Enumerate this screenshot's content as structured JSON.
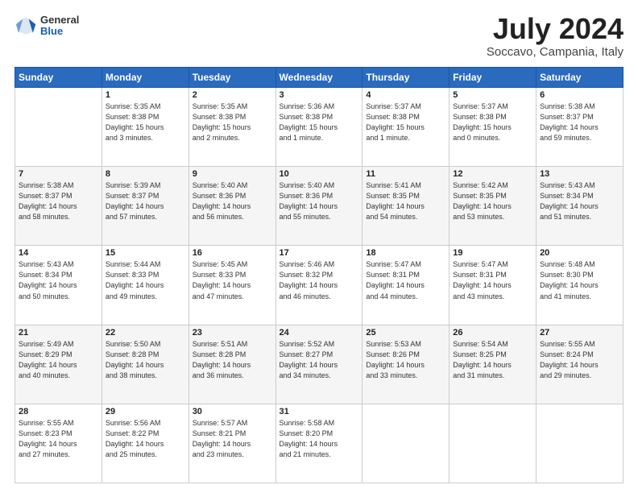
{
  "header": {
    "logo_general": "General",
    "logo_blue": "Blue",
    "month_year": "July 2024",
    "location": "Soccavo, Campania, Italy"
  },
  "calendar": {
    "days_of_week": [
      "Sunday",
      "Monday",
      "Tuesday",
      "Wednesday",
      "Thursday",
      "Friday",
      "Saturday"
    ],
    "weeks": [
      [
        {
          "day": "",
          "info": ""
        },
        {
          "day": "1",
          "info": "Sunrise: 5:35 AM\nSunset: 8:38 PM\nDaylight: 15 hours\nand 3 minutes."
        },
        {
          "day": "2",
          "info": "Sunrise: 5:35 AM\nSunset: 8:38 PM\nDaylight: 15 hours\nand 2 minutes."
        },
        {
          "day": "3",
          "info": "Sunrise: 5:36 AM\nSunset: 8:38 PM\nDaylight: 15 hours\nand 1 minute."
        },
        {
          "day": "4",
          "info": "Sunrise: 5:37 AM\nSunset: 8:38 PM\nDaylight: 15 hours\nand 1 minute."
        },
        {
          "day": "5",
          "info": "Sunrise: 5:37 AM\nSunset: 8:38 PM\nDaylight: 15 hours\nand 0 minutes."
        },
        {
          "day": "6",
          "info": "Sunrise: 5:38 AM\nSunset: 8:37 PM\nDaylight: 14 hours\nand 59 minutes."
        }
      ],
      [
        {
          "day": "7",
          "info": "Sunrise: 5:38 AM\nSunset: 8:37 PM\nDaylight: 14 hours\nand 58 minutes."
        },
        {
          "day": "8",
          "info": "Sunrise: 5:39 AM\nSunset: 8:37 PM\nDaylight: 14 hours\nand 57 minutes."
        },
        {
          "day": "9",
          "info": "Sunrise: 5:40 AM\nSunset: 8:36 PM\nDaylight: 14 hours\nand 56 minutes."
        },
        {
          "day": "10",
          "info": "Sunrise: 5:40 AM\nSunset: 8:36 PM\nDaylight: 14 hours\nand 55 minutes."
        },
        {
          "day": "11",
          "info": "Sunrise: 5:41 AM\nSunset: 8:35 PM\nDaylight: 14 hours\nand 54 minutes."
        },
        {
          "day": "12",
          "info": "Sunrise: 5:42 AM\nSunset: 8:35 PM\nDaylight: 14 hours\nand 53 minutes."
        },
        {
          "day": "13",
          "info": "Sunrise: 5:43 AM\nSunset: 8:34 PM\nDaylight: 14 hours\nand 51 minutes."
        }
      ],
      [
        {
          "day": "14",
          "info": "Sunrise: 5:43 AM\nSunset: 8:34 PM\nDaylight: 14 hours\nand 50 minutes."
        },
        {
          "day": "15",
          "info": "Sunrise: 5:44 AM\nSunset: 8:33 PM\nDaylight: 14 hours\nand 49 minutes."
        },
        {
          "day": "16",
          "info": "Sunrise: 5:45 AM\nSunset: 8:33 PM\nDaylight: 14 hours\nand 47 minutes."
        },
        {
          "day": "17",
          "info": "Sunrise: 5:46 AM\nSunset: 8:32 PM\nDaylight: 14 hours\nand 46 minutes."
        },
        {
          "day": "18",
          "info": "Sunrise: 5:47 AM\nSunset: 8:31 PM\nDaylight: 14 hours\nand 44 minutes."
        },
        {
          "day": "19",
          "info": "Sunrise: 5:47 AM\nSunset: 8:31 PM\nDaylight: 14 hours\nand 43 minutes."
        },
        {
          "day": "20",
          "info": "Sunrise: 5:48 AM\nSunset: 8:30 PM\nDaylight: 14 hours\nand 41 minutes."
        }
      ],
      [
        {
          "day": "21",
          "info": "Sunrise: 5:49 AM\nSunset: 8:29 PM\nDaylight: 14 hours\nand 40 minutes."
        },
        {
          "day": "22",
          "info": "Sunrise: 5:50 AM\nSunset: 8:28 PM\nDaylight: 14 hours\nand 38 minutes."
        },
        {
          "day": "23",
          "info": "Sunrise: 5:51 AM\nSunset: 8:28 PM\nDaylight: 14 hours\nand 36 minutes."
        },
        {
          "day": "24",
          "info": "Sunrise: 5:52 AM\nSunset: 8:27 PM\nDaylight: 14 hours\nand 34 minutes."
        },
        {
          "day": "25",
          "info": "Sunrise: 5:53 AM\nSunset: 8:26 PM\nDaylight: 14 hours\nand 33 minutes."
        },
        {
          "day": "26",
          "info": "Sunrise: 5:54 AM\nSunset: 8:25 PM\nDaylight: 14 hours\nand 31 minutes."
        },
        {
          "day": "27",
          "info": "Sunrise: 5:55 AM\nSunset: 8:24 PM\nDaylight: 14 hours\nand 29 minutes."
        }
      ],
      [
        {
          "day": "28",
          "info": "Sunrise: 5:55 AM\nSunset: 8:23 PM\nDaylight: 14 hours\nand 27 minutes."
        },
        {
          "day": "29",
          "info": "Sunrise: 5:56 AM\nSunset: 8:22 PM\nDaylight: 14 hours\nand 25 minutes."
        },
        {
          "day": "30",
          "info": "Sunrise: 5:57 AM\nSunset: 8:21 PM\nDaylight: 14 hours\nand 23 minutes."
        },
        {
          "day": "31",
          "info": "Sunrise: 5:58 AM\nSunset: 8:20 PM\nDaylight: 14 hours\nand 21 minutes."
        },
        {
          "day": "",
          "info": ""
        },
        {
          "day": "",
          "info": ""
        },
        {
          "day": "",
          "info": ""
        }
      ]
    ]
  }
}
